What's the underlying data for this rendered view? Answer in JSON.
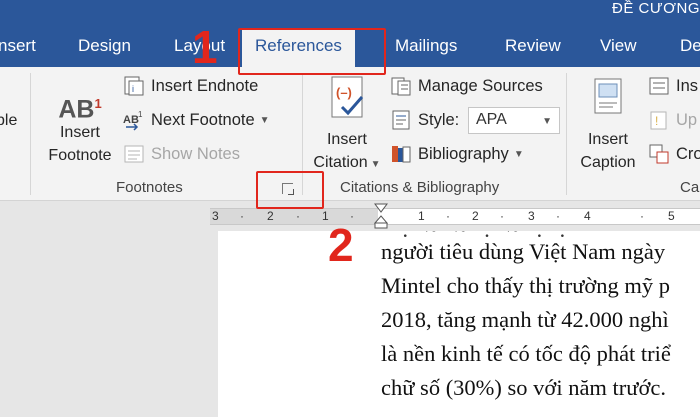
{
  "window": {
    "title": "ĐỀ CƯƠNG"
  },
  "tabs": [
    {
      "label": "nsert"
    },
    {
      "label": "Design"
    },
    {
      "label": "Layout"
    },
    {
      "label": "References"
    },
    {
      "label": "Mailings"
    },
    {
      "label": "Review"
    },
    {
      "label": "View"
    },
    {
      "label": "De"
    }
  ],
  "ribbon": {
    "left_cut": {
      "label": "ple"
    },
    "footnotes": {
      "insert_footnote_lines": [
        "Insert",
        "Footnote"
      ],
      "insert_endnote": "Insert Endnote",
      "next_footnote": "Next Footnote",
      "show_notes": "Show Notes",
      "label": "Footnotes"
    },
    "citations": {
      "insert_citation_lines": [
        "Insert",
        "Citation"
      ],
      "manage_sources": "Manage Sources",
      "style_label": "Style:",
      "style_value": "APA",
      "bibliography": "Bibliography",
      "label": "Citations & Bibliography"
    },
    "captions": {
      "insert_caption_lines": [
        "Insert",
        "Caption"
      ],
      "ins_cut": "Ins",
      "up_cut": "Up",
      "cr_cut": "Cro",
      "label": "Ca"
    }
  },
  "ruler": {
    "ticks": [
      "3",
      "·",
      "2",
      "·",
      "1",
      "·",
      "1",
      "·",
      "2",
      "·",
      "3",
      "·",
      "4",
      "·",
      "5"
    ]
  },
  "document": {
    "lines": [
      "người tiêu dùng Việt Nam ngày",
      "Mintel cho thấy thị trường mỹ p",
      "2018, tăng mạnh từ 42.000 nghì",
      "là nền kinh tế có tốc độ phát triể",
      "chữ số (30%) so với năm trước."
    ]
  },
  "annotations": {
    "step1": "1",
    "step2": "2"
  },
  "colors": {
    "accent": "#2b579a",
    "annotation": "#e1261c"
  }
}
